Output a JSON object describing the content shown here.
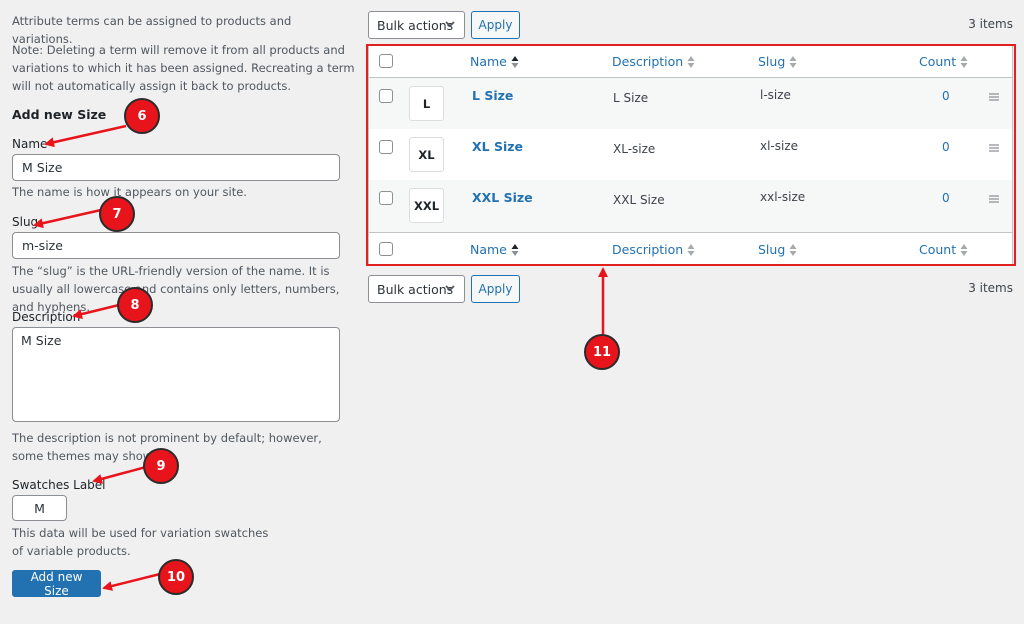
{
  "form": {
    "intro_text": "Attribute terms can be assigned to products and variations.",
    "note_text": "Note: Deleting a term will remove it from all products and variations to which it has been assigned. Recreating a term will not automatically assign it back to products.",
    "heading": "Add new Size",
    "name_label": "Name",
    "name_value": "M Size",
    "name_help": "The name is how it appears on your site.",
    "slug_label": "Slug",
    "slug_value": "m-size",
    "slug_help": "The “slug” is the URL-friendly version of the name. It is usually all lowercase and contains only letters, numbers, and hyphens.",
    "description_label": "Description",
    "description_value": "M Size",
    "description_help": "The description is not prominent by default; however, some themes may show it.",
    "swatches_label": "Swatches Label",
    "swatches_value": "M",
    "swatches_help": "This data will be used for variation swatches of variable products.",
    "submit_label": "Add new Size"
  },
  "table_nav": {
    "bulk_actions": "Bulk actions",
    "apply": "Apply",
    "items_count": "3 items"
  },
  "table": {
    "columns": {
      "name": "Name",
      "description": "Description",
      "slug": "Slug",
      "count": "Count"
    },
    "rows": [
      {
        "swatch": "L",
        "name": "L Size",
        "description": "L Size",
        "slug": "l-size",
        "count": "0"
      },
      {
        "swatch": "XL",
        "name": "XL Size",
        "description": "XL-size",
        "slug": "xl-size",
        "count": "0"
      },
      {
        "swatch": "XXL",
        "name": "XXL Size",
        "description": "XXL Size",
        "slug": "xxl-size",
        "count": "0"
      }
    ]
  },
  "annotations": [
    "6",
    "7",
    "8",
    "9",
    "10",
    "11"
  ],
  "colors": {
    "accent": "#2271b1",
    "annotation": "#e8141c",
    "background": "#f0f0f1"
  }
}
